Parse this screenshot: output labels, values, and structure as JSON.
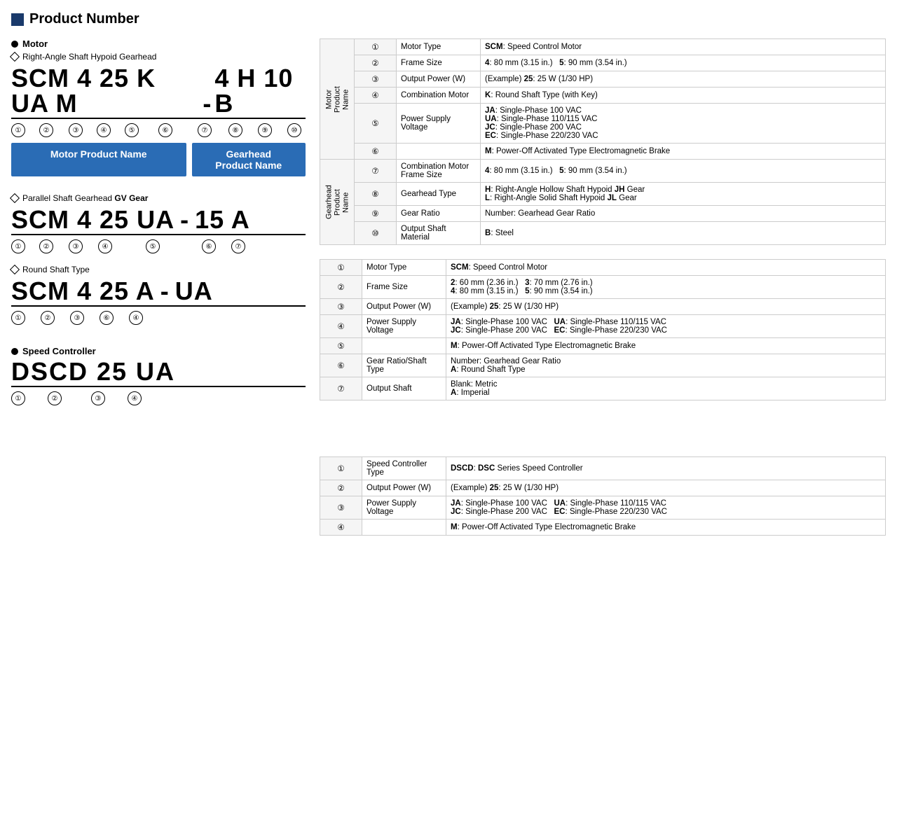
{
  "page": {
    "title": "Product Number"
  },
  "motor_section": {
    "label": "Motor",
    "subsections": [
      {
        "id": "right-angle",
        "heading": "Right-Angle Shaft Hypoid Gearhead",
        "code_parts": [
          {
            "text": "SCM",
            "circles": [
              {
                "num": "①"
              }
            ]
          },
          {
            "text": " 4",
            "circles": [
              {
                "num": "②"
              }
            ]
          },
          {
            "text": " 25",
            "circles": [
              {
                "num": "③"
              }
            ]
          },
          {
            "text": " K",
            "circles": [
              {
                "num": "④"
              }
            ]
          },
          {
            "text": " UA",
            "circles": [
              {
                "num": "⑤"
              }
            ]
          },
          {
            "text": " M",
            "circles": [
              {
                "num": "⑥"
              }
            ]
          },
          {
            "text": " -",
            "circles": []
          },
          {
            "text": " 4",
            "circles": [
              {
                "num": "⑦"
              }
            ]
          },
          {
            "text": " H",
            "circles": [
              {
                "num": "⑧"
              }
            ]
          },
          {
            "text": " 10",
            "circles": [
              {
                "num": "⑨"
              }
            ]
          },
          {
            "text": " B",
            "circles": [
              {
                "num": "⑩"
              }
            ]
          }
        ],
        "motor_box": "Motor Product Name",
        "gearhead_box": "Gearhead\nProduct Name"
      },
      {
        "id": "parallel-shaft",
        "heading": "Parallel Shaft Gearhead GV Gear",
        "heading_bold": "GV Gear",
        "code_display": "SCM 4 25 UA    - 15 A",
        "circles_display": "① ② ③ ④ ⑤    ⑥ ⑦"
      },
      {
        "id": "round-shaft",
        "heading": "Round Shaft Type",
        "code_display": "SCM 4 25 A - UA",
        "circles_display": "① ② ③ ⑥    ④"
      }
    ]
  },
  "speed_controller_section": {
    "label": "Speed Controller",
    "code_display": "DSCD 25 UA",
    "circles_display": "① ② ③ ④"
  },
  "right_angle_table": {
    "rows": [
      {
        "group": "Motor\nProduct\nName",
        "num": "①",
        "name": "Motor Type",
        "value": "<b>SCM</b>: Speed Control Motor"
      },
      {
        "group": "",
        "num": "②",
        "name": "Frame Size",
        "value": "<b>4</b>: 80 mm (3.15 in.)    <b>5</b>: 90 mm (3.54 in.)"
      },
      {
        "group": "",
        "num": "③",
        "name": "Output Power (W)",
        "value": "(Example) <b>25</b>: 25 W (1/30 HP)"
      },
      {
        "group": "",
        "num": "④",
        "name": "Combination Motor",
        "value": "<b>K</b>: Round Shaft Type (with Key)"
      },
      {
        "group": "",
        "num": "⑤",
        "name": "Power Supply Voltage",
        "value": "<b>JA</b>: Single-Phase 100 VAC\n<b>UA</b>: Single-Phase 110/115 VAC\n<b>JC</b>: Single-Phase 200 VAC\n<b>EC</b>: Single-Phase 220/230 VAC"
      },
      {
        "group": "",
        "num": "⑥",
        "name": "",
        "value": "<b>M</b>: Power-Off Activated Type Electromagnetic Brake"
      },
      {
        "group": "Gearhead\nProduct\nName",
        "num": "⑦",
        "name": "Combination Motor\nFrame Size",
        "value": "<b>4</b>: 80 mm (3.15 in.)    <b>5</b>: 90 mm (3.54 in.)"
      },
      {
        "group": "",
        "num": "⑧",
        "name": "Gearhead Type",
        "value": "<b>H</b>: Right-Angle Hollow Shaft Hypoid <b>JH</b> Gear\n<b>L</b>: Right-Angle Solid Shaft Hypoid <b>JL</b> Gear"
      },
      {
        "group": "",
        "num": "⑨",
        "name": "Gear Ratio",
        "value": "Number: Gearhead Gear Ratio"
      },
      {
        "group": "",
        "num": "⑩",
        "name": "Output Shaft Material",
        "value": "<b>B</b>: Steel"
      }
    ]
  },
  "parallel_table": {
    "rows": [
      {
        "num": "①",
        "name": "Motor Type",
        "value": "<b>SCM</b>: Speed Control Motor"
      },
      {
        "num": "②",
        "name": "Frame Size",
        "value": "<b>2</b>: 60 mm (2.36 in.)    <b>3</b>: 70 mm (2.76 in.)\n<b>4</b>: 80 mm (3.15 in.)    <b>5</b>: 90 mm (3.54 in.)"
      },
      {
        "num": "③",
        "name": "Output Power (W)",
        "value": "(Example) <b>25</b>: 25 W (1/30 HP)"
      },
      {
        "num": "④",
        "name": "Power Supply Voltage",
        "value": "<b>JA</b>: Single-Phase 100 VAC    <b>UA</b>: Single-Phase 110/115 VAC\n<b>JC</b>: Single-Phase 200 VAC    <b>EC</b>: Single-Phase 220/230 VAC"
      },
      {
        "num": "⑤",
        "name": "",
        "value": "<b>M</b>: Power-Off Activated Type Electromagnetic Brake"
      },
      {
        "num": "⑥",
        "name": "Gear Ratio/Shaft\nType",
        "value": "Number: Gearhead Gear Ratio\n<b>A</b>: Round Shaft Type"
      },
      {
        "num": "⑦",
        "name": "Output Shaft",
        "value": "Blank: Metric\n<b>A</b>: Imperial"
      }
    ]
  },
  "speed_ctrl_table": {
    "rows": [
      {
        "num": "①",
        "name": "Speed Controller\nType",
        "value": "<b>DSCD</b>: <b>DSC</b> Series Speed Controller"
      },
      {
        "num": "②",
        "name": "Output Power (W)",
        "value": "(Example) <b>25</b>: 25 W (1/30 HP)"
      },
      {
        "num": "③",
        "name": "Power Supply Voltage",
        "value": "<b>JA</b>: Single-Phase 100 VAC    <b>UA</b>: Single-Phase 110/115 VAC\n<b>JC</b>: Single-Phase 200 VAC    <b>EC</b>: Single-Phase 220/230 VAC"
      },
      {
        "num": "④",
        "name": "",
        "value": "<b>M</b>: Power-Off Activated Type Electromagnetic Brake"
      }
    ]
  }
}
